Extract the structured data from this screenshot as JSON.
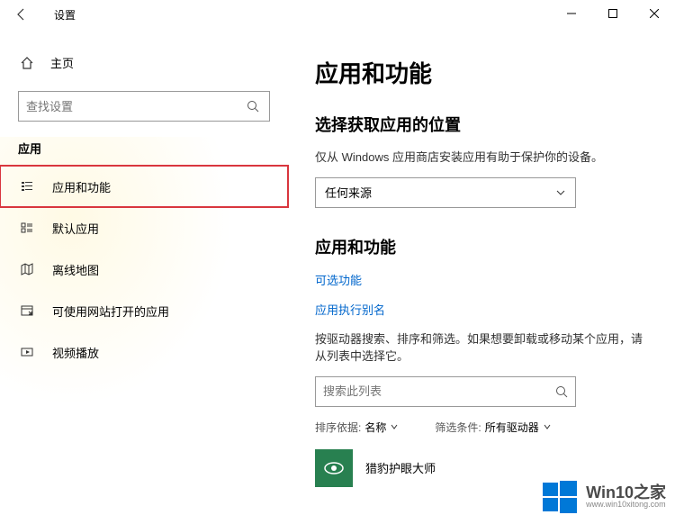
{
  "titlebar": {
    "title": "设置"
  },
  "sidebar": {
    "home": "主页",
    "search_placeholder": "查找设置",
    "section": "应用",
    "items": [
      {
        "label": "应用和功能"
      },
      {
        "label": "默认应用"
      },
      {
        "label": "离线地图"
      },
      {
        "label": "可使用网站打开的应用"
      },
      {
        "label": "视频播放"
      }
    ]
  },
  "main": {
    "heading": "应用和功能",
    "source_heading": "选择获取应用的位置",
    "source_desc": "仅从 Windows 应用商店安装应用有助于保护你的设备。",
    "source_value": "任何来源",
    "apps_heading": "应用和功能",
    "link_optional": "可选功能",
    "link_alias": "应用执行别名",
    "filter_desc": "按驱动器搜索、排序和筛选。如果想要卸载或移动某个应用，请从列表中选择它。",
    "list_search_placeholder": "搜索此列表",
    "sort_label": "排序依据:",
    "sort_value": "名称",
    "filter_label": "筛选条件:",
    "filter_value": "所有驱动器",
    "app0": "猎豹护眼大师"
  },
  "watermark": {
    "big": "Win10之家",
    "small": "www.win10xitong.com"
  }
}
